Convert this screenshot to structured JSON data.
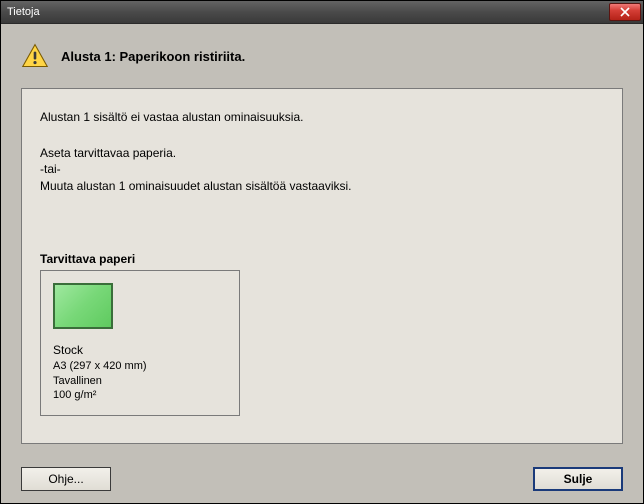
{
  "window": {
    "title": "Tietoja"
  },
  "header": {
    "title": "Alusta 1: Paperikoon ristiriita."
  },
  "message": {
    "line1": "Alustan 1 sisältö ei vastaa alustan ominaisuuksia.",
    "line2": "Aseta tarvittavaa paperia.",
    "line3": "-tai-",
    "line4": "Muuta alustan 1 ominaisuudet alustan sisältöä vastaaviksi."
  },
  "required": {
    "label": "Tarvittava paperi",
    "stock_name": "Stock",
    "dimension": "A3 (297 x 420 mm)",
    "type": "Tavallinen",
    "weight": "100 g/m²"
  },
  "buttons": {
    "help": "Ohje...",
    "close": "Sulje"
  },
  "colors": {
    "swatch": "#7ed87e"
  }
}
